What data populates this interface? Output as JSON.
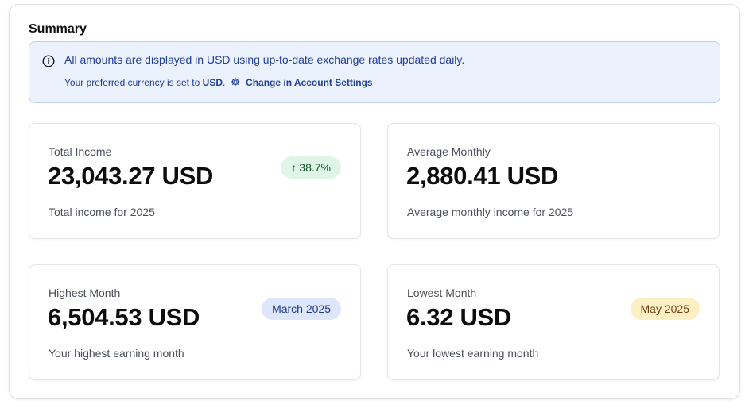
{
  "summary": {
    "title": "Summary",
    "banner": {
      "info_icon": "info-icon",
      "message": "All amounts are displayed in USD using up-to-date exchange rates updated daily.",
      "currency_prefix": "Your preferred currency is set to",
      "currency": "USD",
      "currency_suffix": ".",
      "gear_icon": "gear-icon",
      "settings_link": "Change in Account Settings"
    },
    "cards": [
      {
        "label": "Total Income",
        "value": "23,043.27 USD",
        "description": "Total income for 2025",
        "badge": {
          "icon": "arrow-up-icon",
          "arrow": "↑",
          "text": "38.7%",
          "color": "#dff5e5"
        }
      },
      {
        "label": "Average Monthly",
        "value": "2,880.41 USD",
        "description": "Average monthly income for 2025"
      },
      {
        "label": "Highest Month",
        "value": "6,504.53 USD",
        "description": "Your highest earning month",
        "badge": {
          "text": "March 2025",
          "color": "#dde6fb"
        }
      },
      {
        "label": "Lowest Month",
        "value": "6.32 USD",
        "description": "Your lowest earning month",
        "badge": {
          "text": "May 2025",
          "color": "#fcefc4"
        }
      }
    ]
  },
  "colors": {
    "banner_bg": "#ebf2fd",
    "banner_text": "#1f3f99",
    "positive": "#14532d",
    "warning": "#713f12"
  }
}
